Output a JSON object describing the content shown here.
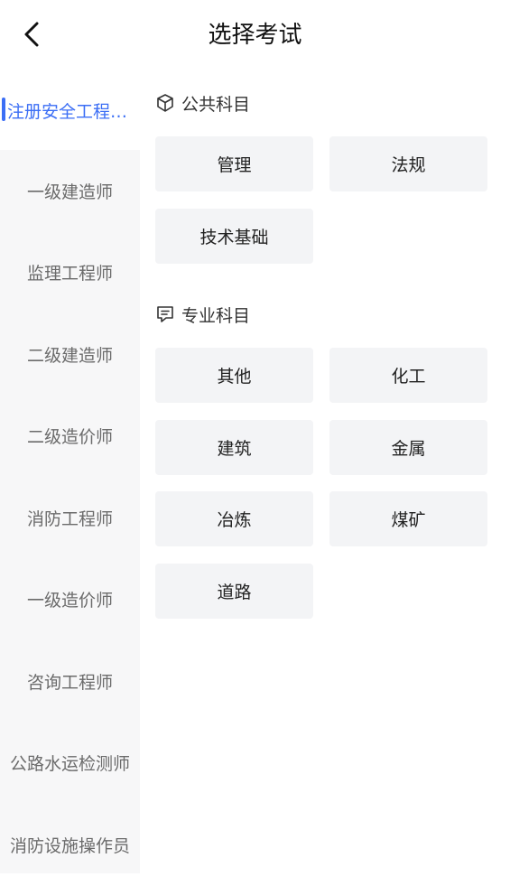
{
  "header": {
    "title": "选择考试",
    "back_icon": "chevron-left-icon"
  },
  "sidebar": {
    "items": [
      {
        "label": "注册安全工程师…",
        "active": true
      },
      {
        "label": "一级建造师"
      },
      {
        "label": "监理工程师"
      },
      {
        "label": "二级建造师"
      },
      {
        "label": "二级造价师"
      },
      {
        "label": "消防工程师"
      },
      {
        "label": "一级造价师"
      },
      {
        "label": "咨询工程师"
      },
      {
        "label": "公路水运检测师"
      },
      {
        "label": "消防设施操作员"
      }
    ],
    "accent_color": "#3b6ef5"
  },
  "sections": {
    "public": {
      "title": "公共科目",
      "icon": "cube-icon",
      "subjects": [
        "管理",
        "法规",
        "技术基础"
      ]
    },
    "major": {
      "title": "专业科目",
      "icon": "comment-icon",
      "subjects": [
        "其他",
        "化工",
        "建筑",
        "金属",
        "冶炼",
        "煤矿",
        "道路"
      ]
    }
  }
}
